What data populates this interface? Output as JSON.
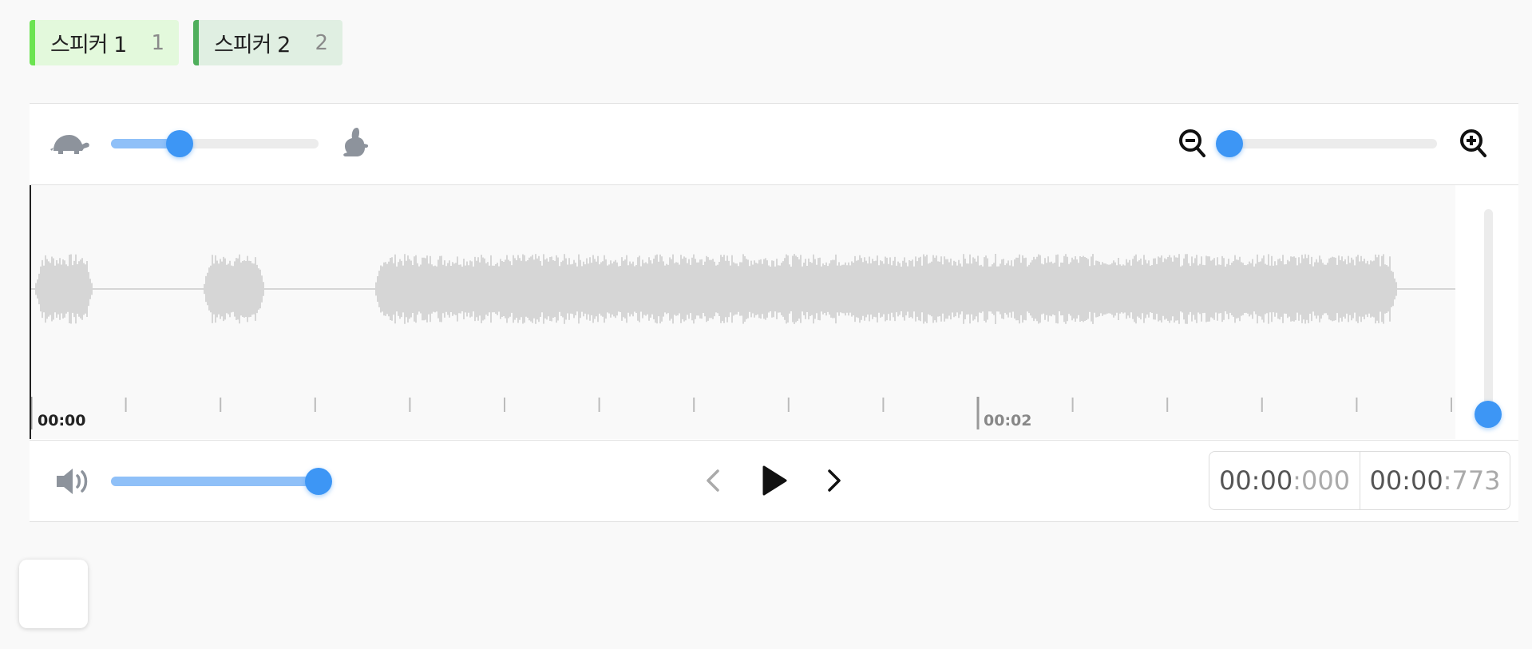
{
  "labels": [
    {
      "name": "스피커 1",
      "hotkey": "1",
      "color": "#6be450"
    },
    {
      "name": "스피커 2",
      "hotkey": "2",
      "color": "#4faf5c"
    }
  ],
  "controls": {
    "speed": {
      "value": 0.33,
      "slow_icon": "turtle-icon",
      "fast_icon": "rabbit-icon"
    },
    "zoom": {
      "value": 0.0,
      "out_icon": "zoom-out-icon",
      "in_icon": "zoom-in-icon"
    },
    "volume": {
      "value": 1.0,
      "icon": "volume-icon"
    },
    "vertical_zoom": {
      "value": 0.0
    }
  },
  "timeline": {
    "start_label": "00:00",
    "mid_label": "00:02"
  },
  "time": {
    "current_main": "00:00",
    "current_ms": ":000",
    "total_main": "00:00",
    "total_ms": ":773"
  },
  "playback": {
    "prev_icon": "chevron-left-icon",
    "play_icon": "play-icon",
    "next_icon": "chevron-right-icon"
  },
  "colors": {
    "accent": "#3d96f5",
    "waveform": "#d6d6d6"
  }
}
